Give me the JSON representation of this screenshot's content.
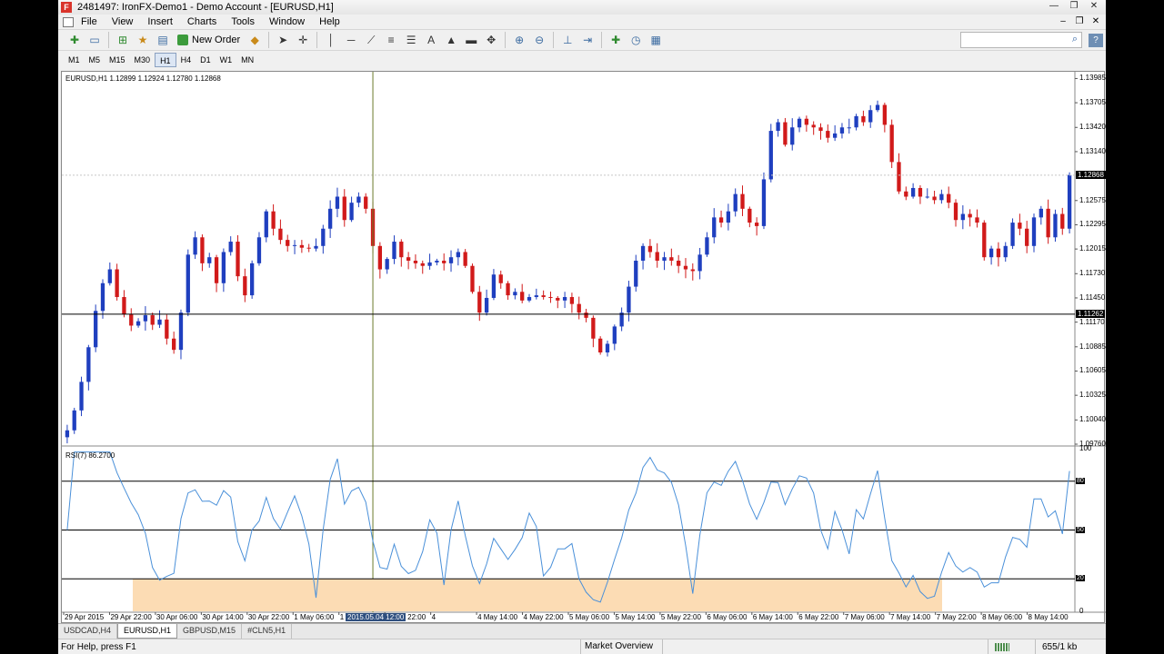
{
  "window": {
    "logo_letter": "F",
    "title": "2481497: IronFX-Demo1 - Demo Account - [EURUSD,H1]",
    "controls": [
      "—",
      "❐",
      "✕"
    ]
  },
  "menu": {
    "items": [
      "File",
      "View",
      "Insert",
      "Charts",
      "Tools",
      "Window",
      "Help"
    ],
    "mdi_controls": [
      "–",
      "❐",
      "✕"
    ]
  },
  "toolbar": {
    "new_order_label": "New Order",
    "text_tool_label": "A",
    "search_placeholder": "",
    "help_label": "?"
  },
  "timeframes": {
    "items": [
      "M1",
      "M5",
      "M15",
      "M30",
      "H1",
      "H4",
      "D1",
      "W1",
      "MN"
    ],
    "active": "H1"
  },
  "chart": {
    "info": "EURUSD,H1  1.12899 1.12924 1.12780 1.12868",
    "current_price_tag": "1.12868",
    "crosshair_price_tag": "1.11262",
    "crosshair_time_tag": "2015.05.04 12:00",
    "price_axis": [
      "1.13985",
      "1.13705",
      "1.13420",
      "1.13140",
      "1.12575",
      "1.12295",
      "1.12015",
      "1.11730",
      "1.11450",
      "1.11170",
      "1.10885",
      "1.10605",
      "1.10325",
      "1.10040",
      "1.09760"
    ],
    "time_axis": [
      "29 Apr 2015",
      "29 Apr 22:00",
      "30 Apr 06:00",
      "30 Apr 14:00",
      "30 Apr 22:00",
      "1 May 06:00",
      "1 May 14:00",
      "1 May 22:00",
      "4",
      "4 May 14:00",
      "4 May 22:00",
      "5 May 06:00",
      "5 May 14:00",
      "5 May 22:00",
      "6 May 06:00",
      "6 May 14:00",
      "6 May 22:00",
      "7 May 06:00",
      "7 May 14:00",
      "7 May 22:00",
      "8 May 06:00",
      "8 May 14:00"
    ],
    "bull_color": "#1f3fbf",
    "bear_color": "#d11a1a",
    "crosshair_color": "#6b7a2a"
  },
  "indicator": {
    "label": "RSI(7) 86.2700",
    "axis": [
      "100",
      "80",
      "50",
      "20",
      "0"
    ],
    "line_color": "#4a90d9",
    "highlight_color": "#fcdcb4"
  },
  "chart_data": {
    "type": "candlestick",
    "symbol": "EURUSD",
    "timeframe": "H1",
    "ylim": [
      1.0976,
      1.14
    ],
    "open_high_low_close_last": [
      1.12899,
      1.12924,
      1.1278,
      1.12868
    ],
    "series": [
      {
        "name": "EURUSD,H1",
        "closes": [
          1.0992,
          1.1015,
          1.1048,
          1.1088,
          1.113,
          1.1162,
          1.1178,
          1.1146,
          1.1126,
          1.1113,
          1.1118,
          1.1125,
          1.1114,
          1.112,
          1.1098,
          1.1085,
          1.1128,
          1.1195,
          1.1215,
          1.1185,
          1.1192,
          1.1162,
          1.1198,
          1.121,
          1.117,
          1.1148,
          1.1185,
          1.1215,
          1.1245,
          1.1225,
          1.1212,
          1.1205,
          1.1206,
          1.1203,
          1.1202,
          1.1205,
          1.1225,
          1.1248,
          1.1262,
          1.1235,
          1.1255,
          1.1262,
          1.1248,
          1.1205,
          1.1178,
          1.119,
          1.121,
          1.1192,
          1.1188,
          1.1185,
          1.1182,
          1.1186,
          1.1188,
          1.1185,
          1.1192,
          1.1198,
          1.1182,
          1.1152,
          1.1128,
          1.1145,
          1.1172,
          1.1162,
          1.1148,
          1.1152,
          1.1142,
          1.1146,
          1.1148,
          1.1146,
          1.1145,
          1.1142,
          1.1146,
          1.1138,
          1.1128,
          1.1122,
          1.1098,
          1.1082,
          1.1092,
          1.1112,
          1.1128,
          1.1158,
          1.1188,
          1.1205,
          1.1198,
          1.1188,
          1.1192,
          1.1188,
          1.1182,
          1.1178,
          1.1176,
          1.1195,
          1.1215,
          1.1238,
          1.1232,
          1.1245,
          1.1265,
          1.1248,
          1.1232,
          1.1228,
          1.1282,
          1.1338,
          1.1348,
          1.1322,
          1.1342,
          1.1352,
          1.1345,
          1.1342,
          1.1338,
          1.133,
          1.1335,
          1.1342,
          1.1342,
          1.1355,
          1.1348,
          1.1362,
          1.1368,
          1.1345,
          1.1302,
          1.1268,
          1.1262,
          1.1272,
          1.1262,
          1.1262,
          1.1258,
          1.1265,
          1.1255,
          1.1235,
          1.1242,
          1.1238,
          1.1232,
          1.1192,
          1.1202,
          1.1192,
          1.1205,
          1.1232,
          1.1225,
          1.1205,
          1.1238,
          1.1248,
          1.1215,
          1.1242,
          1.1225,
          1.1287
        ]
      }
    ],
    "indicator": {
      "name": "RSI(7)",
      "last": 86.27,
      "levels": [
        80,
        50,
        20
      ],
      "range": [
        0,
        100
      ]
    }
  }
}
